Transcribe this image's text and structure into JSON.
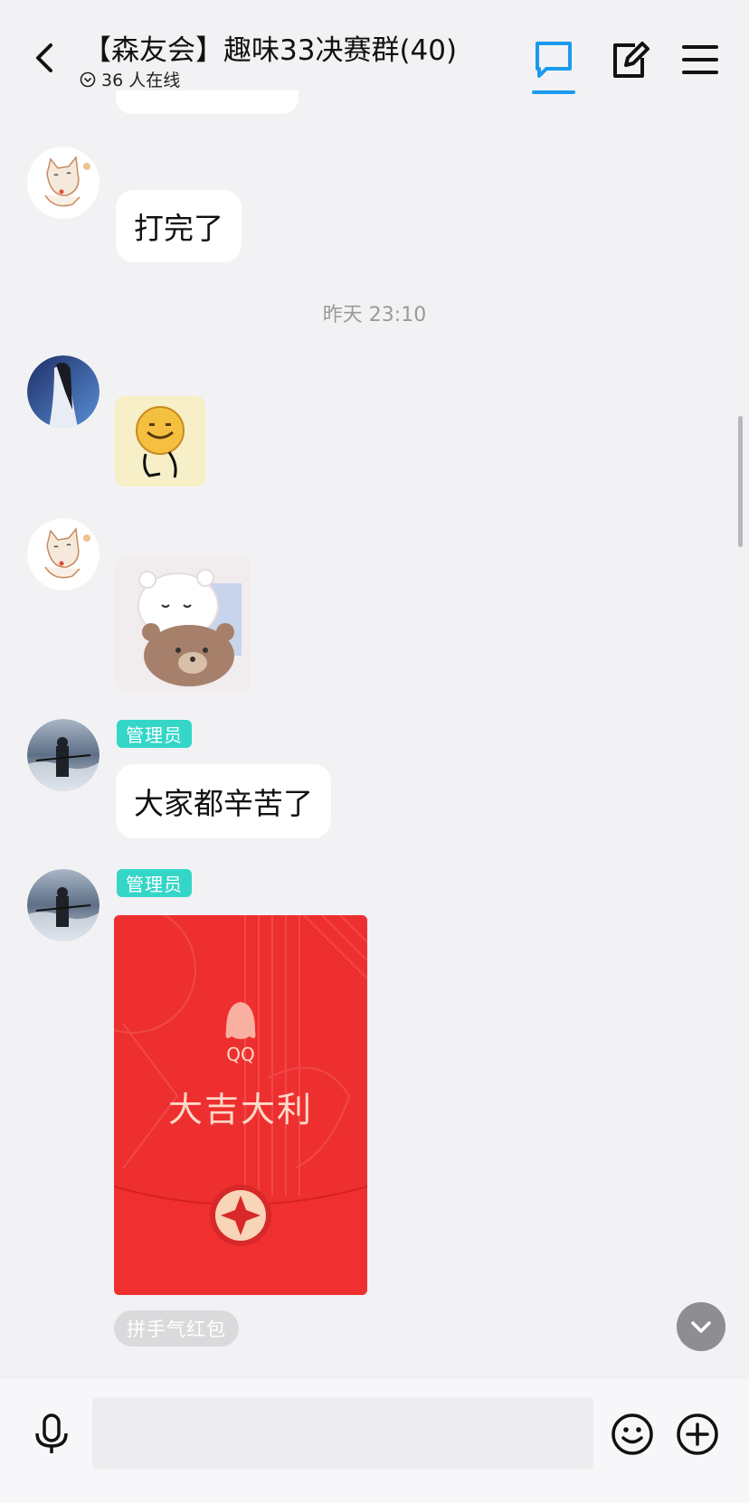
{
  "header": {
    "title": "【森友会】趣味33决赛群(40)",
    "online": "36 人在线"
  },
  "timestamp": "昨天 23:10",
  "messages": [
    {
      "text": "打完了"
    },
    {
      "badge": "管理员",
      "text": "大家都辛苦了"
    },
    {
      "badge": "管理员"
    }
  ],
  "redpacket": {
    "brand": "QQ",
    "greeting": "大吉大利",
    "type_label": "拼手气红包"
  },
  "input": {
    "placeholder": ""
  },
  "colors": {
    "accent": "#1a9af0",
    "badge": "#34d6c8",
    "redpacket": "#ee2f2f"
  }
}
